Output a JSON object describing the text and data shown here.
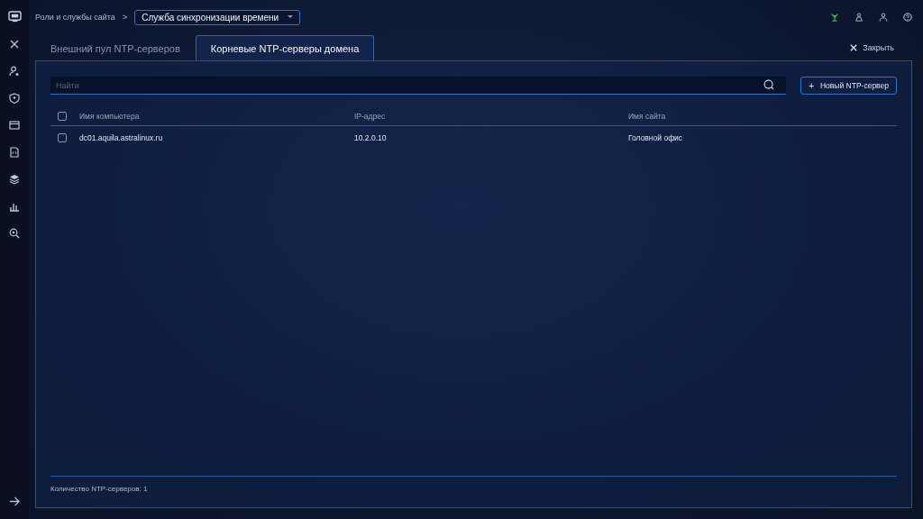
{
  "breadcrumb": {
    "parent": "Роли и службы сайта",
    "separator": ">",
    "current": "Служба синхронизации времени"
  },
  "tabs": [
    {
      "label": "Внешний пул NTP-серверов",
      "selected": false
    },
    {
      "label": "Корневые NTP-серверы домена",
      "selected": true
    }
  ],
  "close_label": "Закрыть",
  "search": {
    "placeholder": "Найти"
  },
  "new_button": "Новый NTP-сервер",
  "new_button_icon": "+",
  "table": {
    "header_checked": false,
    "columns": [
      "Имя компьютера",
      "IP-адрес",
      "Имя сайта"
    ],
    "rows": [
      {
        "checked": false,
        "cells": [
          "dc01.aquila.astralinux.ru",
          "10.2.0.10",
          "Головной офис"
        ]
      }
    ]
  },
  "footer": "Количество NTP-серверов: 1"
}
